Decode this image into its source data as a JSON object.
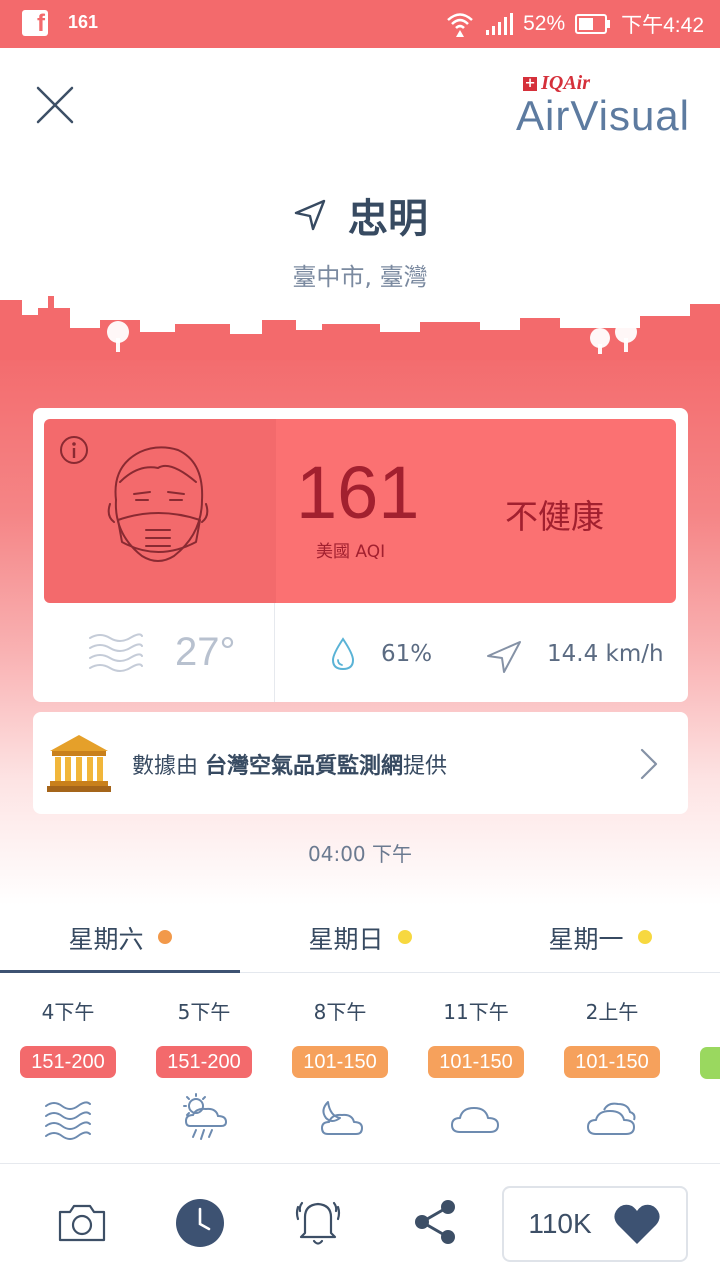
{
  "status_bar": {
    "notification_count": "161",
    "battery": "52%",
    "time": "下午4:42"
  },
  "brand": {
    "company": "IQAir",
    "app_name_a": "Air",
    "app_name_b": "Visual"
  },
  "location": {
    "name": "忠明",
    "region": "臺中市, 臺灣"
  },
  "aqi": {
    "value": "161",
    "unit": "美國 AQI",
    "status": "不健康",
    "color": "#f36a6c"
  },
  "weather": {
    "temperature": "27°",
    "humidity": "61%",
    "wind": "14.4 km/h"
  },
  "source": {
    "prefix": "數據由 ",
    "name": "台灣空氣品質監測網",
    "suffix": "提供"
  },
  "update_time": "04:00 下午",
  "day_tabs": [
    {
      "label": "星期六",
      "dot_color": "#f2994a"
    },
    {
      "label": "星期日",
      "dot_color": "#f7d83f"
    },
    {
      "label": "星期一",
      "dot_color": "#f7d83f"
    }
  ],
  "hourly": [
    {
      "time": "4下午",
      "range": "151-200",
      "color": "#f36a6c",
      "icon": "haze-icon"
    },
    {
      "time": "5下午",
      "range": "151-200",
      "color": "#f36a6c",
      "icon": "sun-cloud-rain-icon"
    },
    {
      "time": "8下午",
      "range": "101-150",
      "color": "#f6a15c",
      "icon": "moon-cloud-icon"
    },
    {
      "time": "11下午",
      "range": "101-150",
      "color": "#f6a15c",
      "icon": "cloud-icon"
    },
    {
      "time": "2上午",
      "range": "101-150",
      "color": "#f6a15c",
      "icon": "clouds-icon"
    }
  ],
  "favorites": {
    "count": "110K"
  }
}
